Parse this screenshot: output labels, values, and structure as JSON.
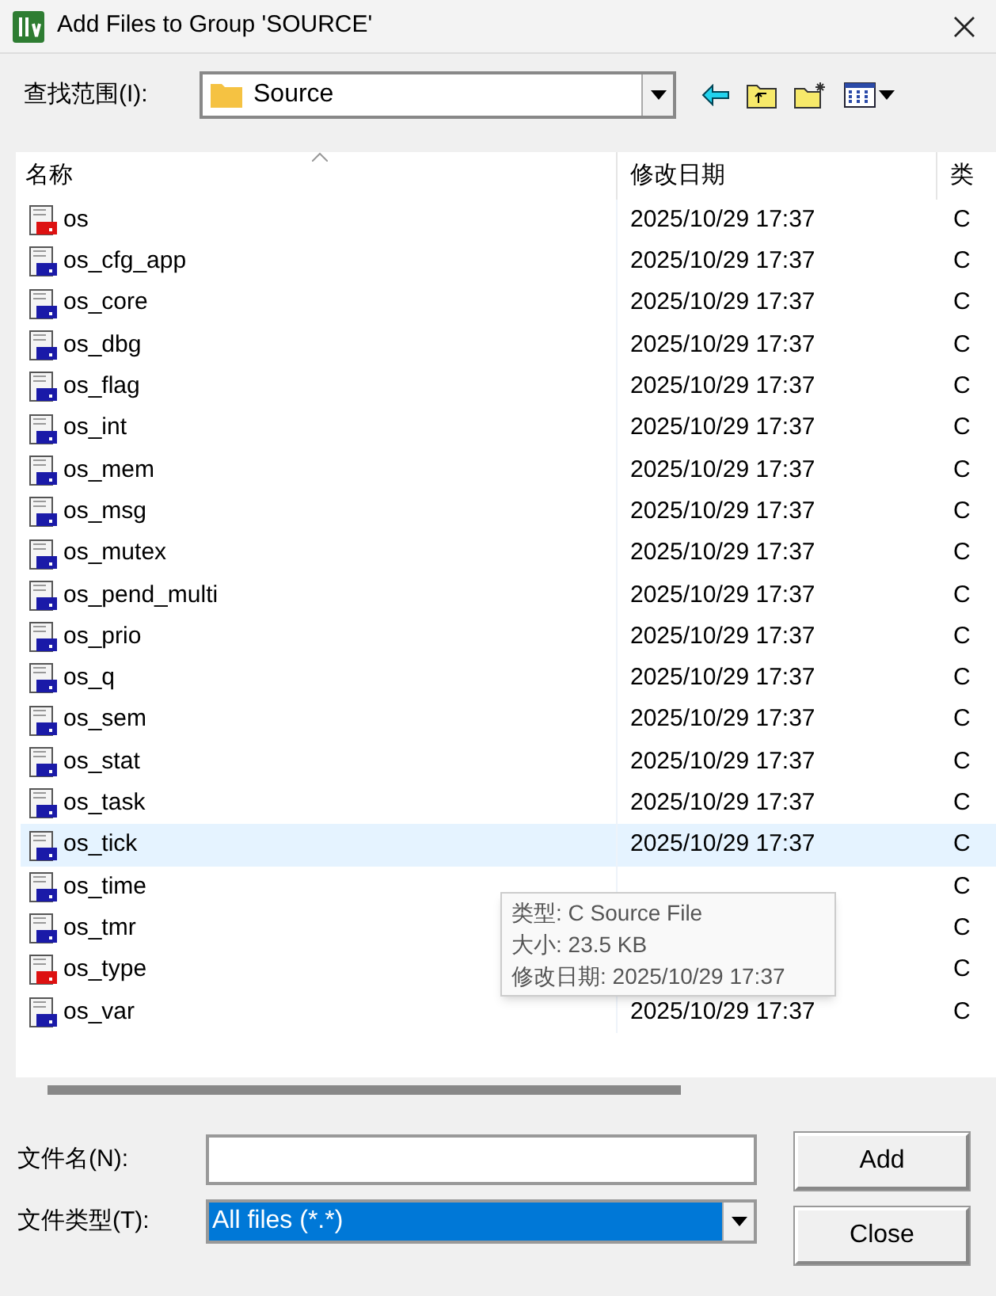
{
  "window": {
    "title": "Add Files to Group 'SOURCE'"
  },
  "look_in": {
    "label": "查找范围(I):",
    "value": "Source"
  },
  "table": {
    "columns": [
      "名称",
      "修改日期",
      "类"
    ],
    "rows": [
      {
        "name": "os",
        "date": "2025/10/29 17:37",
        "type": "C",
        "kind": "header",
        "selected": false
      },
      {
        "name": "os_cfg_app",
        "date": "2025/10/29 17:37",
        "type": "C",
        "kind": "source",
        "selected": false
      },
      {
        "name": "os_core",
        "date": "2025/10/29 17:37",
        "type": "C",
        "kind": "source",
        "selected": false
      },
      {
        "name": "os_dbg",
        "date": "2025/10/29 17:37",
        "type": "C",
        "kind": "source",
        "selected": false
      },
      {
        "name": "os_flag",
        "date": "2025/10/29 17:37",
        "type": "C",
        "kind": "source",
        "selected": false
      },
      {
        "name": "os_int",
        "date": "2025/10/29 17:37",
        "type": "C",
        "kind": "source",
        "selected": false
      },
      {
        "name": "os_mem",
        "date": "2025/10/29 17:37",
        "type": "C",
        "kind": "source",
        "selected": false
      },
      {
        "name": "os_msg",
        "date": "2025/10/29 17:37",
        "type": "C",
        "kind": "source",
        "selected": false
      },
      {
        "name": "os_mutex",
        "date": "2025/10/29 17:37",
        "type": "C",
        "kind": "source",
        "selected": false
      },
      {
        "name": "os_pend_multi",
        "date": "2025/10/29 17:37",
        "type": "C",
        "kind": "source",
        "selected": false
      },
      {
        "name": "os_prio",
        "date": "2025/10/29 17:37",
        "type": "C",
        "kind": "source",
        "selected": false
      },
      {
        "name": "os_q",
        "date": "2025/10/29 17:37",
        "type": "C",
        "kind": "source",
        "selected": false
      },
      {
        "name": "os_sem",
        "date": "2025/10/29 17:37",
        "type": "C",
        "kind": "source",
        "selected": false
      },
      {
        "name": "os_stat",
        "date": "2025/10/29 17:37",
        "type": "C",
        "kind": "source",
        "selected": false
      },
      {
        "name": "os_task",
        "date": "2025/10/29 17:37",
        "type": "C",
        "kind": "source",
        "selected": false
      },
      {
        "name": "os_tick",
        "date": "2025/10/29 17:37",
        "type": "C",
        "kind": "source",
        "selected": true
      },
      {
        "name": "os_time",
        "type": "C",
        "kind": "source",
        "selected": false
      },
      {
        "name": "os_tmr",
        "type": "C",
        "kind": "source",
        "selected": false
      },
      {
        "name": "os_type",
        "type": "C",
        "kind": "header",
        "selected": false
      },
      {
        "name": "os_var",
        "date": "2025/10/29 17:37",
        "type": "C",
        "kind": "source",
        "selected": false
      }
    ]
  },
  "tooltip": [
    "类型: C Source File",
    "大小: 23.5 KB",
    "修改日期: 2025/10/29 17:37"
  ],
  "file_name": {
    "label": "文件名(N):"
  },
  "file_type": {
    "label": "文件类型(T):",
    "value": "All files (*.*)"
  },
  "buttons": [
    "Add",
    "Close"
  ]
}
